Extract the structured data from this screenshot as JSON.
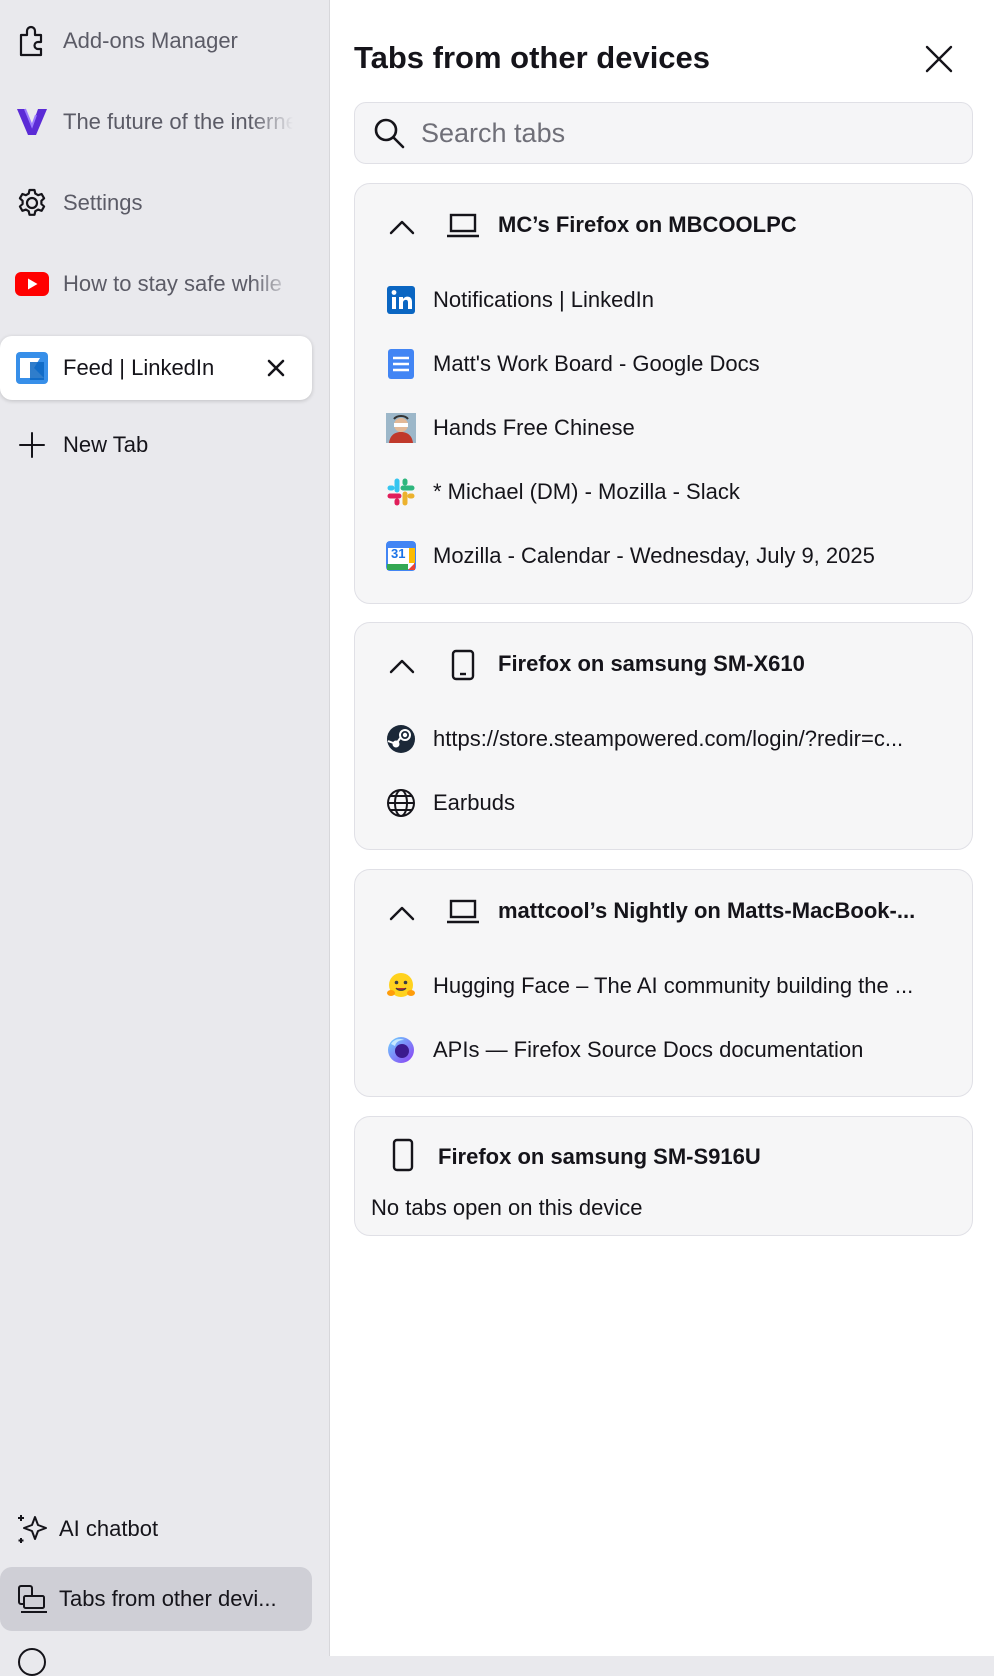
{
  "tabstrip": {
    "tabs": [
      {
        "label": "Add-ons Manager",
        "icon": "puzzle-icon"
      },
      {
        "label": "The future of the internet",
        "icon": "v-logo-icon"
      },
      {
        "label": "Settings",
        "icon": "gear-icon"
      },
      {
        "label": "How to stay safe while",
        "icon": "youtube-icon"
      },
      {
        "label": "Feed | LinkedIn",
        "icon": "linkedin-feed-icon",
        "selected": true
      }
    ],
    "new_tab_label": "New Tab",
    "bottom": {
      "ai_chatbot_label": "AI chatbot",
      "synced_tabs_label": "Tabs from other devi..."
    }
  },
  "panel": {
    "title": "Tabs from other devices",
    "search_placeholder": "Search tabs",
    "devices": [
      {
        "name": "MC’s Firefox on MBCOOLPC",
        "device_icon": "laptop-icon",
        "tabs": [
          {
            "title": "Notifications | LinkedIn",
            "icon": "linkedin-icon"
          },
          {
            "title": "Matt's Work Board - Google Docs",
            "icon": "google-docs-icon"
          },
          {
            "title": "Hands Free Chinese",
            "icon": "avatar-favicon"
          },
          {
            "title": "* Michael (DM) - Mozilla - Slack",
            "icon": "slack-icon"
          },
          {
            "title": "Mozilla - Calendar - Wednesday, July 9, 2025",
            "icon": "google-calendar-icon",
            "calendar_day": "31"
          }
        ]
      },
      {
        "name": "Firefox on samsung SM-X610",
        "device_icon": "tablet-icon",
        "tabs": [
          {
            "title": "https://store.steampowered.com/login/?redir=c...",
            "icon": "steam-icon"
          },
          {
            "title": "Earbuds",
            "icon": "globe-icon"
          }
        ]
      },
      {
        "name": "mattcool’s Nightly on Matts-MacBook-...",
        "device_icon": "laptop-icon",
        "tabs": [
          {
            "title": "Hugging Face – The AI community building the ...",
            "icon": "hugging-face-icon"
          },
          {
            "title": "APIs — Firefox Source Docs documentation",
            "icon": "firefox-nightly-icon"
          }
        ]
      },
      {
        "name": "Firefox on samsung SM-S916U",
        "device_icon": "phone-icon",
        "empty_message": "No tabs open on this device"
      }
    ]
  },
  "colors": {
    "strip_bg": "#e9e9ed",
    "panel_bg": "#ffffff",
    "card_bg": "#f6f6f7",
    "accent_purple": "#5b2bd6",
    "youtube_red": "#ff0000",
    "linkedin_blue": "#0a66c2",
    "active_item_bg": "#cfcfd6"
  }
}
